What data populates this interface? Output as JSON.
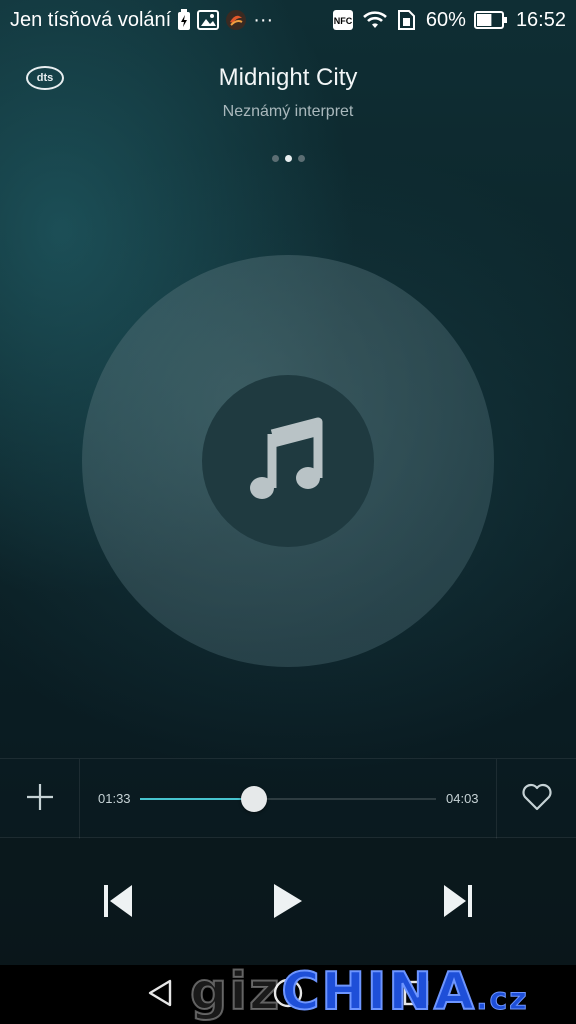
{
  "status_bar": {
    "carrier": "Jen tísňová volání",
    "nfc_label": "NFC",
    "battery_percent": "60%",
    "battery_level": 0.6,
    "time": "16:52",
    "more": "···"
  },
  "header": {
    "dts_logo": "dts",
    "title": "Midnight City",
    "artist": "Neznámý interpret",
    "pages": 3,
    "active_page": 1
  },
  "player": {
    "elapsed": "01:33",
    "total": "04:03",
    "progress": 0.386,
    "accent_color": "#48c4cf"
  },
  "icons": {
    "add": "plus-icon",
    "favorite": "heart-icon",
    "previous": "skip-previous-icon",
    "play": "play-icon",
    "next": "skip-next-icon",
    "album_art": "music-note-icon",
    "nav_back": "back-triangle-icon",
    "nav_home": "home-circle-icon",
    "nav_recent": "recent-square-icon"
  },
  "watermark": {
    "part1": "giz",
    "part2": "CHINA",
    "part3": ".cz"
  }
}
